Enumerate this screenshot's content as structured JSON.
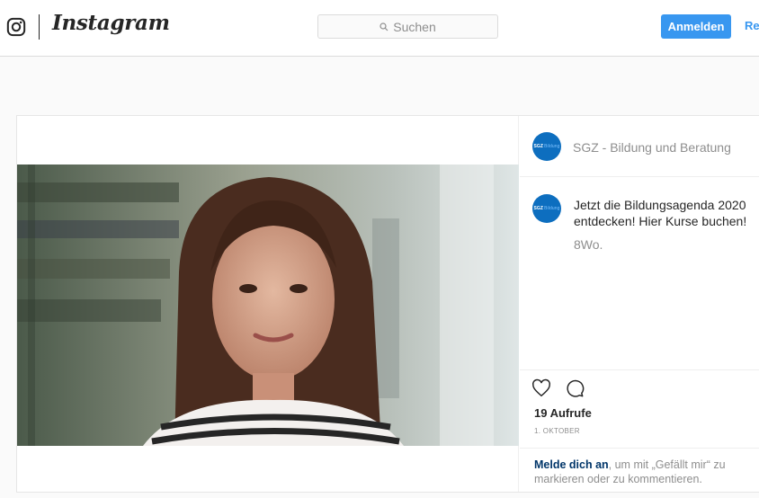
{
  "header": {
    "brand": "Instagram",
    "search_placeholder": "Suchen",
    "login_label": "Anmelden",
    "register_label": "Re"
  },
  "post": {
    "account_name": "SGZ - Bildung und Beratung",
    "avatar_text": "SGZ",
    "avatar_subtext": "Bildung",
    "caption": "Jetzt die Bildungsagenda 2020 entdecken! Hier Kurse buchen!",
    "age": "8Wo.",
    "views": "19 Aufrufe",
    "date": "1. OKTOBER",
    "login_link": "Melde dich an",
    "login_rest": ", um mit „Gefällt mir“ zu markieren oder zu kommentieren."
  },
  "icons": {
    "header": [
      "instagram-glyph-icon",
      "search-icon"
    ],
    "actions": [
      "heart-icon",
      "comment-icon"
    ]
  },
  "colors": {
    "accent": "#3897f0",
    "avatar": "#0d6ebf",
    "link_dark": "#003569",
    "muted": "#8e8e8e"
  }
}
